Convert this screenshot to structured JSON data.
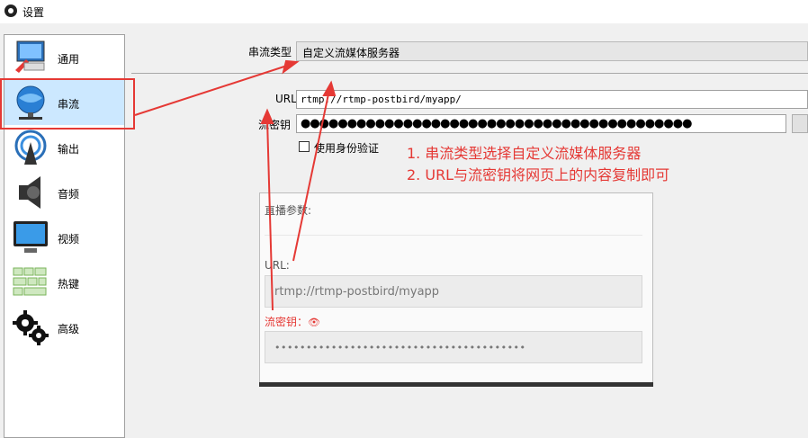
{
  "window": {
    "title": "设置"
  },
  "sidebar": {
    "items": [
      {
        "label": "通用",
        "icon": "monitor-checklist-icon"
      },
      {
        "label": "串流",
        "icon": "globe-network-icon"
      },
      {
        "label": "输出",
        "icon": "broadcast-antenna-icon"
      },
      {
        "label": "音频",
        "icon": "speaker-icon"
      },
      {
        "label": "视频",
        "icon": "display-icon"
      },
      {
        "label": "热键",
        "icon": "keyboard-keys-icon"
      },
      {
        "label": "高级",
        "icon": "gears-icon"
      }
    ],
    "selected_index": 1
  },
  "stream": {
    "type_label": "串流类型",
    "type_value": "自定义流媒体服务器",
    "url_label": "URL",
    "url_value": "rtmp://rtmp-postbird/myapp/",
    "key_label": "流密钥",
    "key_value": "●●●●●●●●●●●●●●●●●●●●●●●●●●●●●●●●●●●●●●●●●●",
    "auth_label": "使用身份验证",
    "auth_checked": false
  },
  "annotations": {
    "note1": "1. 串流类型选择自定义流媒体服务器",
    "note2": "2. URL与流密钥将网页上的内容复制即可",
    "color": "#e53935"
  },
  "web_card": {
    "title": "直播参数:",
    "url_label": "URL:",
    "url_value": "rtmp://rtmp-postbird/myapp",
    "key_label": "流密钥：",
    "key_icon": "eye-icon",
    "key_value": "••••••••••••••••••••••••••••••••••••••••"
  },
  "colors": {
    "selection": "#cce8ff",
    "accent": "#e53935",
    "panel": "#f0f0f0"
  }
}
